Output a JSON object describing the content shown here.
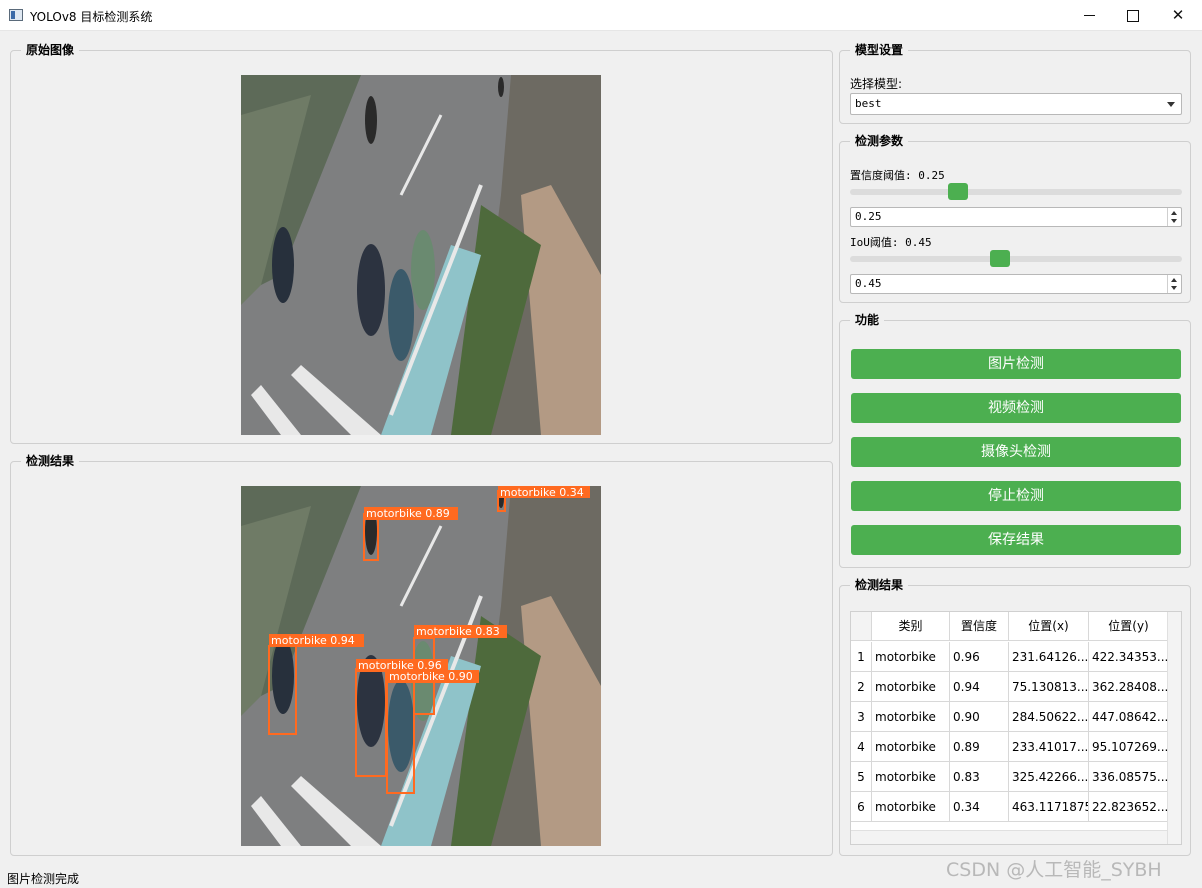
{
  "window": {
    "title": "YOLOv8 目标检测系统",
    "minimize": "—",
    "maximize": "☐",
    "close": "✕"
  },
  "original_panel": {
    "title": "原始图像"
  },
  "result_panel": {
    "title": "检测结果"
  },
  "model_settings": {
    "title": "模型设置",
    "label": "选择模型:",
    "selected": "best"
  },
  "params": {
    "title": "检测参数",
    "conf_label": "置信度阈值: 0.25",
    "conf_value": "0.25",
    "conf_fraction": 0.25,
    "iou_label": "IoU阈值: 0.45",
    "iou_value": "0.45",
    "iou_fraction": 0.45
  },
  "functions": {
    "title": "功能",
    "buttons": [
      "图片检测",
      "视频检测",
      "摄像头检测",
      "停止检测",
      "保存结果"
    ]
  },
  "results": {
    "title": "检测结果",
    "headers": [
      "类别",
      "置信度",
      "位置(x)",
      "位置(y)"
    ],
    "rows": [
      {
        "idx": "1",
        "cls": "motorbike",
        "conf": "0.96",
        "x": "231.64126...",
        "y": "422.34353..."
      },
      {
        "idx": "2",
        "cls": "motorbike",
        "conf": "0.94",
        "x": "75.130813...",
        "y": "362.28408..."
      },
      {
        "idx": "3",
        "cls": "motorbike",
        "conf": "0.90",
        "x": "284.50622...",
        "y": "447.08642..."
      },
      {
        "idx": "4",
        "cls": "motorbike",
        "conf": "0.89",
        "x": "233.41017...",
        "y": "95.107269..."
      },
      {
        "idx": "5",
        "cls": "motorbike",
        "conf": "0.83",
        "x": "325.42266...",
        "y": "336.08575..."
      },
      {
        "idx": "6",
        "cls": "motorbike",
        "conf": "0.34",
        "x": "463.1171875",
        "y": "22.823652..."
      }
    ]
  },
  "detections": [
    {
      "label": "motorbike 0.34"
    },
    {
      "label": "motorbike 0.89"
    },
    {
      "label": "motorbike 0.94"
    },
    {
      "label": "motorbike 0.83"
    },
    {
      "label": "motorbike 0.96"
    },
    {
      "label": "motorbike 0.90"
    }
  ],
  "status": "图片检测完成",
  "watermark": "CSDN @人工智能_SYBH",
  "colors": {
    "accent": "#4caf50",
    "box": "#ff6a20"
  }
}
